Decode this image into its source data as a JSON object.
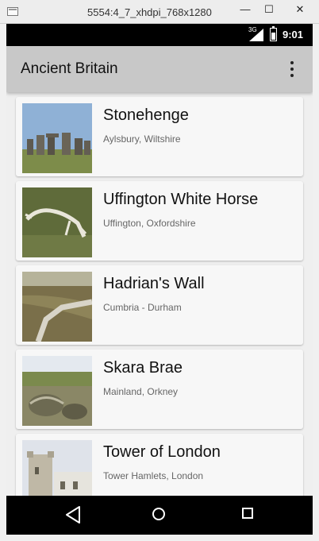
{
  "window": {
    "title": "5554:4_7_xhdpi_768x1280",
    "minimize": "—",
    "maximize": "☐",
    "close": "✕"
  },
  "status_bar": {
    "network": "3G",
    "time": "9:01"
  },
  "app_bar": {
    "title": "Ancient Britain",
    "overflow_icon": "more-vert-icon"
  },
  "places": [
    {
      "name": "Stonehenge",
      "location": "Aylsbury, Wiltshire"
    },
    {
      "name": "Uffington White Horse",
      "location": "Uffington, Oxfordshire"
    },
    {
      "name": "Hadrian's Wall",
      "location": "Cumbria - Durham"
    },
    {
      "name": "Skara Brae",
      "location": "Mainland, Orkney"
    },
    {
      "name": "Tower of London",
      "location": "Tower Hamlets, London"
    }
  ],
  "nav_bar": {
    "back_icon": "back-icon",
    "home_icon": "home-icon",
    "recents_icon": "recents-icon"
  }
}
